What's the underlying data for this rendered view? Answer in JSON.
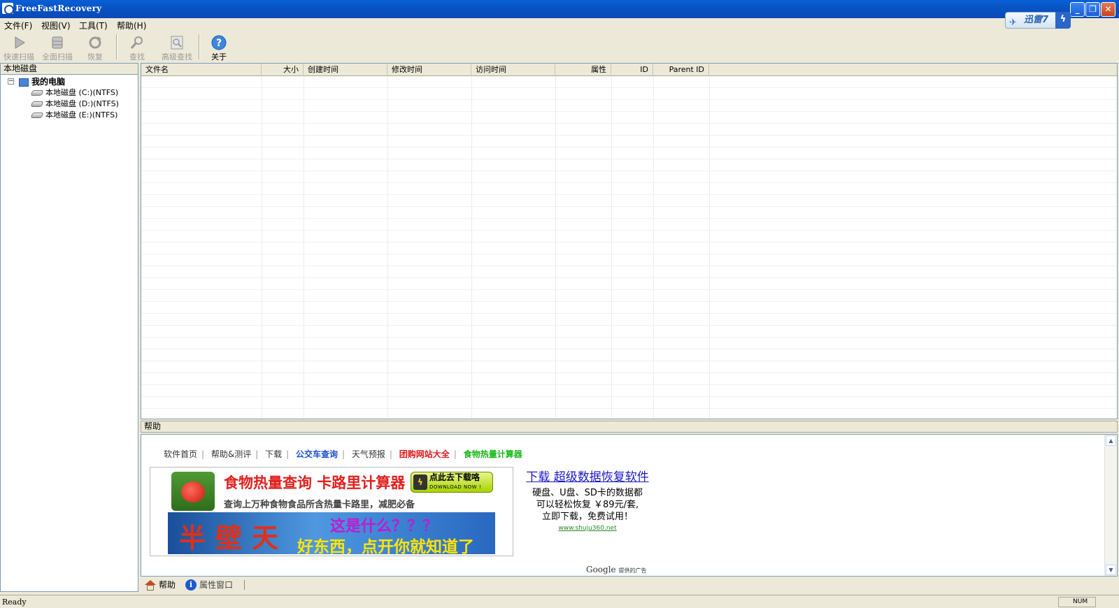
{
  "window": {
    "title": "FreeFastRecovery",
    "minimize": "_",
    "restore": "❐",
    "close": "✕"
  },
  "xunlei_badge": "迅雷7",
  "menu": [
    "文件(F)",
    "视图(V)",
    "工具(T)",
    "帮助(H)"
  ],
  "toolbar": {
    "quick_scan": "快速扫描",
    "full_scan": "全面扫描",
    "recover": "恢复",
    "find": "查找",
    "advanced_find": "高级查找",
    "about": "关于"
  },
  "left_panel": {
    "header": "本地磁盘",
    "root": "我的电脑",
    "drives": [
      "本地磁盘 (C:)(NTFS)",
      "本地磁盘 (D:)(NTFS)",
      "本地磁盘 (E:)(NTFS)"
    ]
  },
  "grid": {
    "columns": [
      "文件名",
      "大小",
      "创建时间",
      "修改时间",
      "访问时间",
      "属性",
      "ID",
      "Parent ID"
    ]
  },
  "help_panel": {
    "header": "帮助",
    "links": [
      "软件首页",
      "帮助&测评",
      "下载",
      "公交车查询",
      "天气预报",
      "团购网站大全",
      "食物热量计算器"
    ],
    "link_colors": [
      "#333333",
      "#333333",
      "#333333",
      "#1a4fd0",
      "#333333",
      "#e01818",
      "#18b818"
    ],
    "ad": {
      "title": "食物热量查询 卡路里计算器",
      "download_btn": "点此去下载咯",
      "download_sub": "DOWNLOAD NOW !",
      "subtitle": "查询上万种食物食品所含热量卡路里，减肥必备",
      "banner_left": "半壁天",
      "banner_question": "这是什么？？？",
      "banner_answer": "好东西，点开你就知道了"
    },
    "right_ad": {
      "link": "下载 超级数据恢复软件",
      "lines": [
        "硬盘、U盘、SD卡的数据都",
        "可以轻松恢复 ￥89元/套,",
        "立即下载，免费试用！"
      ],
      "url": "www.shuju360.net"
    },
    "google": "Google",
    "google_note": "提供的广告"
  },
  "bottom_tabs": [
    "帮助",
    "属性窗口"
  ],
  "status": {
    "text": "Ready",
    "num": "NUM"
  }
}
